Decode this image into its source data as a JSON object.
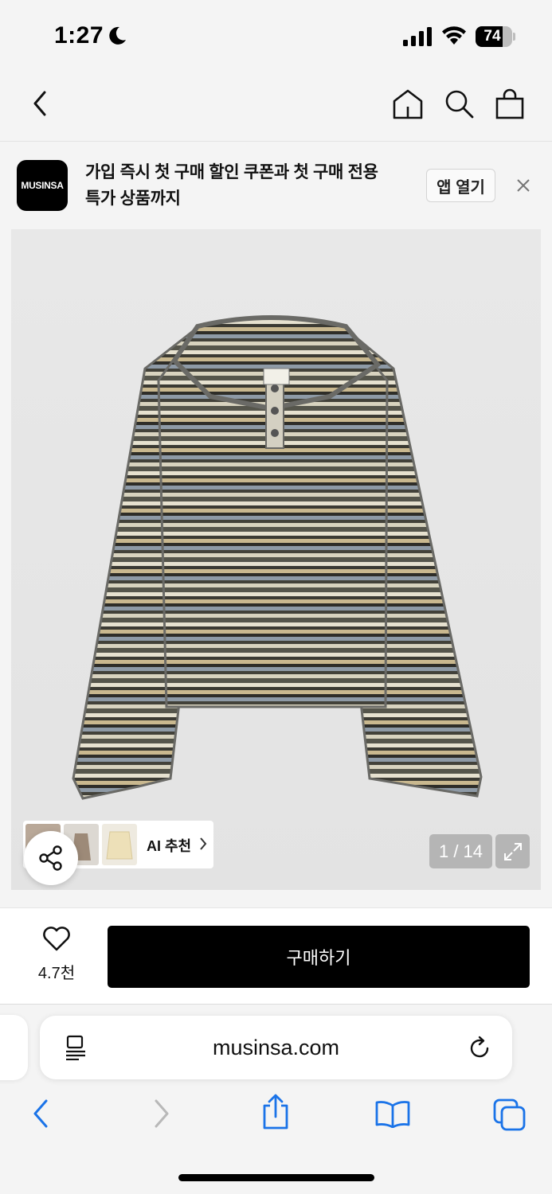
{
  "status_bar": {
    "time": "1:27",
    "battery": "74",
    "battery_level": 0.74
  },
  "nav": {
    "icons": [
      "back-icon",
      "home-icon",
      "search-icon",
      "shopping-bag-icon"
    ]
  },
  "banner": {
    "logo_text": "MUSINSA",
    "message_line1": "가입 즉시 첫 구매 할인 쿠폰과 첫 구매 전용",
    "message_line2": "특가 상품까지",
    "open_app_label": "앱 열기"
  },
  "product": {
    "ai_recommend_label": "AI 추천",
    "image_counter": "1 / 14"
  },
  "purchase": {
    "like_count": "4.7천",
    "buy_label": "구매하기"
  },
  "browser": {
    "url": "musinsa.com"
  },
  "colors": {
    "accent": "#000000",
    "link_blue": "#1a73e8",
    "background": "#f4f4f4"
  }
}
